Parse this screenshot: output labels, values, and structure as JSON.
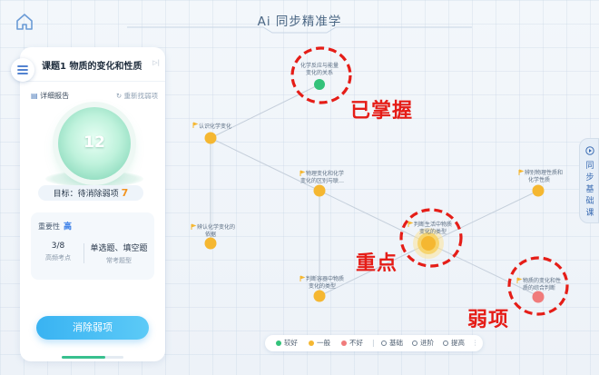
{
  "header": {
    "title": "Ai 同步精准学"
  },
  "panel": {
    "lesson_title": "课题1 物质的变化和性质",
    "collapse_icon": "▷|",
    "report_label": "详细报告",
    "refind_label": "重新找弱项",
    "orb_value": "12",
    "goal_label": "目标：待消除弱项",
    "goal_count": "7",
    "importance_label": "重要性",
    "importance_value": "高",
    "stat1_value": "3/8",
    "stat1_label": "高频考点",
    "stat2_value": "单选题、填空题",
    "stat2_label": "常考题型",
    "clear_button": "消除弱项",
    "progress": 0.7
  },
  "side_tab": {
    "label": "同步基础课"
  },
  "map": {
    "nodes": [
      {
        "id": "n1",
        "label1": "化学反应与能量",
        "label2": "变化的关系",
        "status": "good"
      },
      {
        "id": "n2",
        "label1": "认识化学变化",
        "label2": "",
        "status": "fair"
      },
      {
        "id": "n3",
        "label1": "物理变化和化学",
        "label2": "变化的区别与联…",
        "status": "fair"
      },
      {
        "id": "n4",
        "label1": "辨认化学变化的",
        "label2": "依据",
        "status": "fair"
      },
      {
        "id": "n5",
        "label1": "判断生活中物质",
        "label2": "变化的类型",
        "status": "fair"
      },
      {
        "id": "n6",
        "label1": "判断容器中物质",
        "label2": "变化的类型",
        "status": "fair"
      },
      {
        "id": "n7",
        "label1": "辨别物理性质和",
        "label2": "化学性质",
        "status": "fair"
      },
      {
        "id": "n8",
        "label1": "物质的变化和性",
        "label2": "质的综合判断",
        "status": "poor"
      }
    ]
  },
  "legend": {
    "good": "较好",
    "fair": "一般",
    "poor": "不好",
    "basic": "基础",
    "advanced": "进阶",
    "improve": "提高",
    "more": "⋮"
  },
  "annotations": {
    "mastered": "已掌握",
    "key": "重点",
    "weak": "弱项"
  },
  "colors": {
    "good": "#33c27a",
    "fair": "#f5b731",
    "poor": "#f07b7b",
    "accent": "#2e77e6",
    "annotation": "#e51d17"
  }
}
